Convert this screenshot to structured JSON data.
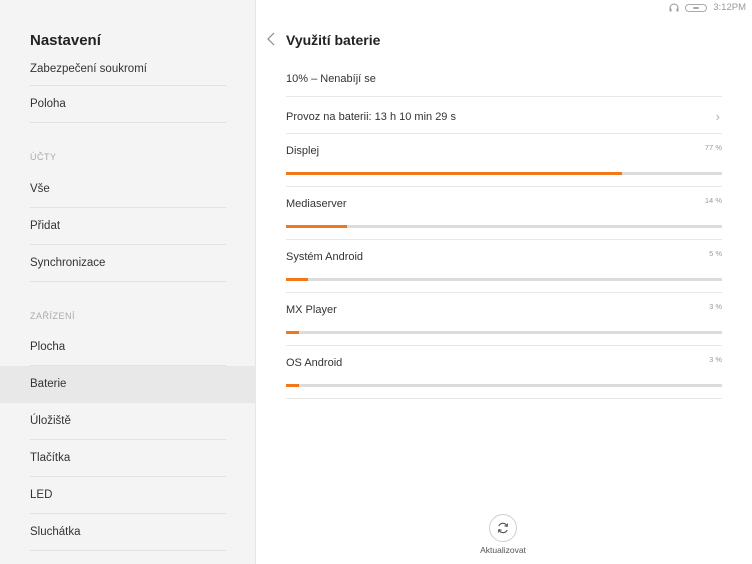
{
  "status": {
    "time": "3:12PM"
  },
  "sidebar": {
    "title": "Nastavení",
    "items_top": [
      "Zabezpečení soukromí",
      "Poloha"
    ],
    "section_accounts": "ÚČTY",
    "items_accounts": [
      "Vše",
      "Přidat",
      "Synchronizace"
    ],
    "section_device": "ZAŘÍZENÍ",
    "items_device": [
      "Plocha",
      "Baterie",
      "Úložiště",
      "Tlačítka",
      "LED",
      "Sluchátka"
    ],
    "active_item": "Baterie"
  },
  "main": {
    "title": "Využití baterie",
    "charge_status": "10% – Nenabíjí se",
    "runtime": "Provoz na baterii: 13 h 10 min 29 s",
    "apps": [
      {
        "name": "Displej",
        "percent_label": "77 %",
        "usage": 0.77
      },
      {
        "name": "Mediaserver",
        "percent_label": "14 %",
        "usage": 0.14
      },
      {
        "name": "Systém Android",
        "percent_label": "5 %",
        "usage": 0.05
      },
      {
        "name": "MX Player",
        "percent_label": "3 %",
        "usage": 0.03
      },
      {
        "name": "OS Android",
        "percent_label": "3 %",
        "usage": 0.03
      }
    ],
    "refresh_label": "Aktualizovat"
  },
  "colors": {
    "accent": "#f0771a",
    "track": "#dcdcdc"
  },
  "icons": {
    "back": "chevron-left-icon",
    "refresh": "refresh-icon",
    "headphones": "headphones-icon",
    "battery": "battery-icon",
    "row_more": "chevron-right-icon"
  }
}
